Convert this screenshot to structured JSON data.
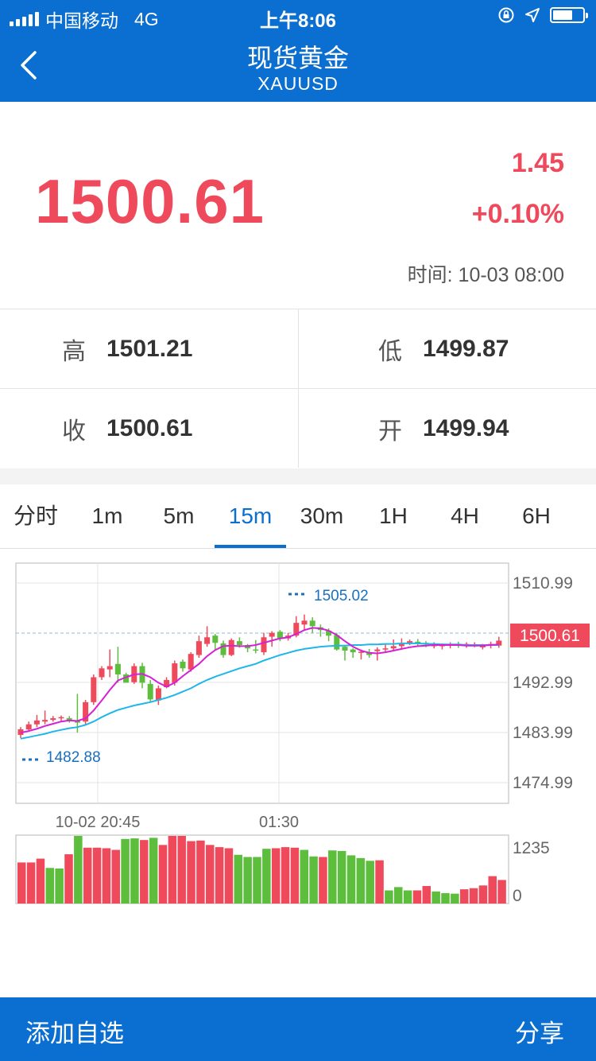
{
  "status_bar": {
    "carrier": "中国移动",
    "network": "4G",
    "time": "上午8:06"
  },
  "header": {
    "title": "现货黄金",
    "subtitle": "XAUUSD"
  },
  "quote": {
    "price": "1500.61",
    "change": "1.45",
    "change_pct": "+0.10%",
    "time_label": "时间:",
    "time_value": "10-03 08:00",
    "color_up": "#ef4a5c",
    "color_down": "#5cbe3c"
  },
  "stats": {
    "high_label": "高",
    "high": "1501.21",
    "low_label": "低",
    "low": "1499.87",
    "close_label": "收",
    "close": "1500.61",
    "open_label": "开",
    "open": "1499.94"
  },
  "tabs": [
    {
      "label": "分时",
      "active": false
    },
    {
      "label": "1m",
      "active": false
    },
    {
      "label": "5m",
      "active": false
    },
    {
      "label": "15m",
      "active": true
    },
    {
      "label": "30m",
      "active": false
    },
    {
      "label": "1H",
      "active": false
    },
    {
      "label": "4H",
      "active": false
    },
    {
      "label": "6H",
      "active": false
    }
  ],
  "chart_data": {
    "type": "candlestick",
    "y_ticks": [
      "1510.99",
      "1492.99",
      "1483.99",
      "1474.99"
    ],
    "ylim": [
      1474.99,
      1510.99
    ],
    "current_price_label": "1500.61",
    "max_label": "1505.02",
    "min_label": "1482.88",
    "x_labels": [
      "10-02 20:45",
      "01:30"
    ],
    "volume_ticks": [
      "1235",
      "0"
    ],
    "volume_max": 1235,
    "candles": [
      [
        1483.6,
        1484.6,
        1483.0,
        1485.0
      ],
      [
        1484.6,
        1485.5,
        1484.2,
        1486.0
      ],
      [
        1485.5,
        1486.2,
        1485.0,
        1487.2
      ],
      [
        1486.0,
        1486.3,
        1485.5,
        1488.0
      ],
      [
        1486.3,
        1486.6,
        1486.0,
        1487.0
      ],
      [
        1486.7,
        1486.8,
        1486.0,
        1487.1
      ],
      [
        1486.6,
        1486.2,
        1485.8,
        1487.0
      ],
      [
        1486.2,
        1485.8,
        1484.0,
        1491.0
      ],
      [
        1486.0,
        1489.5,
        1485.5,
        1489.9
      ],
      [
        1489.5,
        1494.0,
        1489.0,
        1494.5
      ],
      [
        1494.0,
        1495.6,
        1493.5,
        1496.0
      ],
      [
        1495.4,
        1496.0,
        1494.0,
        1499.0
      ],
      [
        1496.4,
        1494.5,
        1493.0,
        1499.5
      ],
      [
        1494.5,
        1493.0,
        1493.0,
        1494.8
      ],
      [
        1493.1,
        1496.0,
        1492.8,
        1496.5
      ],
      [
        1496.0,
        1493.0,
        1492.0,
        1496.6
      ],
      [
        1492.8,
        1490.0,
        1489.5,
        1493.5
      ],
      [
        1489.8,
        1492.0,
        1489.0,
        1492.5
      ],
      [
        1492.2,
        1493.5,
        1492.0,
        1494.0
      ],
      [
        1493.0,
        1496.5,
        1492.5,
        1497.0
      ],
      [
        1496.8,
        1495.6,
        1495.0,
        1497.2
      ],
      [
        1495.4,
        1498.2,
        1495.0,
        1498.5
      ],
      [
        1498.0,
        1500.5,
        1497.5,
        1501.5
      ],
      [
        1500.0,
        1501.2,
        1499.5,
        1503.2
      ],
      [
        1501.5,
        1500.2,
        1498.8,
        1501.8
      ],
      [
        1500.1,
        1498.0,
        1497.5,
        1500.6
      ],
      [
        1498.0,
        1500.7,
        1497.8,
        1501.0
      ],
      [
        1500.5,
        1499.8,
        1499.3,
        1501.2
      ],
      [
        1499.8,
        1499.2,
        1498.5,
        1500.0
      ],
      [
        1499.0,
        1498.8,
        1498.3,
        1500.7
      ],
      [
        1498.5,
        1501.2,
        1498.0,
        1502.0
      ],
      [
        1501.3,
        1502.0,
        1499.5,
        1502.3
      ],
      [
        1502.2,
        1501.0,
        1500.5,
        1502.5
      ],
      [
        1501.0,
        1501.5,
        1500.6,
        1502.0
      ],
      [
        1501.5,
        1503.8,
        1501.2,
        1505.0
      ],
      [
        1503.5,
        1504.2,
        1502.5,
        1505.3
      ],
      [
        1504.2,
        1503.2,
        1502.0,
        1504.8
      ],
      [
        1503.0,
        1502.5,
        1501.3,
        1503.5
      ],
      [
        1502.4,
        1501.5,
        1500.5,
        1502.8
      ],
      [
        1501.6,
        1499.0,
        1498.8,
        1502.0
      ],
      [
        1499.5,
        1498.8,
        1497.0,
        1499.8
      ],
      [
        1499.0,
        1498.5,
        1497.5,
        1499.2
      ],
      [
        1498.6,
        1498.6,
        1497.2,
        1499.0
      ],
      [
        1498.4,
        1498.0,
        1497.5,
        1499.1
      ],
      [
        1498.7,
        1499.0,
        1497.0,
        1499.4
      ],
      [
        1499.0,
        1499.2,
        1498.5,
        1500.0
      ],
      [
        1499.2,
        1499.6,
        1498.8,
        1500.8
      ],
      [
        1499.6,
        1500.0,
        1499.0,
        1501.0
      ],
      [
        1500.0,
        1500.5,
        1499.8,
        1500.8
      ],
      [
        1500.4,
        1500.2,
        1499.6,
        1500.9
      ],
      [
        1500.2,
        1500.1,
        1499.4,
        1500.5
      ],
      [
        1499.7,
        1499.8,
        1499.2,
        1500.3
      ],
      [
        1499.8,
        1499.8,
        1499.0,
        1500.1
      ],
      [
        1499.7,
        1499.9,
        1499.2,
        1500.3
      ],
      [
        1499.9,
        1499.7,
        1499.3,
        1500.4
      ],
      [
        1499.6,
        1500.0,
        1499.3,
        1500.3
      ],
      [
        1499.8,
        1499.9,
        1499.4,
        1500.3
      ],
      [
        1499.5,
        1499.6,
        1499.0,
        1500.0
      ],
      [
        1499.7,
        1500.0,
        1499.2,
        1500.4
      ],
      [
        1499.7,
        1500.6,
        1499.3,
        1501.3
      ]
    ],
    "ma_magenta": [
      1484.0,
      1484.3,
      1484.7,
      1485.2,
      1485.6,
      1486.0,
      1486.2,
      1486.1,
      1486.6,
      1488.0,
      1489.8,
      1491.7,
      1493.4,
      1494.0,
      1494.5,
      1494.6,
      1494.0,
      1493.0,
      1492.3,
      1493.0,
      1494.2,
      1495.3,
      1496.4,
      1497.8,
      1498.9,
      1499.6,
      1499.7,
      1499.6,
      1499.6,
      1499.8,
      1500.2,
      1500.6,
      1501.0,
      1501.2,
      1501.8,
      1502.5,
      1502.9,
      1502.8,
      1502.4,
      1501.6,
      1500.5,
      1499.5,
      1498.8,
      1498.4,
      1498.3,
      1498.5,
      1498.8,
      1499.1,
      1499.4,
      1499.6,
      1499.7,
      1499.8,
      1499.8,
      1499.8,
      1499.8,
      1499.7,
      1499.7,
      1499.7,
      1499.8,
      1499.9
    ],
    "ma_cyan": [
      1482.9,
      1483.2,
      1483.5,
      1483.8,
      1484.2,
      1484.5,
      1484.8,
      1485.0,
      1485.4,
      1486.0,
      1486.8,
      1487.5,
      1488.1,
      1488.5,
      1488.9,
      1489.2,
      1489.5,
      1489.9,
      1490.3,
      1490.8,
      1491.4,
      1492.0,
      1492.8,
      1493.5,
      1494.1,
      1494.6,
      1495.1,
      1495.6,
      1496.0,
      1496.4,
      1497.0,
      1497.5,
      1498.0,
      1498.4,
      1498.8,
      1499.1,
      1499.3,
      1499.5,
      1499.6,
      1499.7,
      1499.7,
      1499.8,
      1499.8,
      1499.9,
      1499.9,
      1500.0,
      1500.0,
      1500.1,
      1500.1,
      1500.1,
      1500.0,
      1500.0,
      1499.9,
      1499.9,
      1499.9,
      1499.8,
      1499.8,
      1499.8,
      1499.8,
      1499.8
    ],
    "volume": [
      {
        "v": 750,
        "up": true
      },
      {
        "v": 750,
        "up": true
      },
      {
        "v": 820,
        "up": true
      },
      {
        "v": 650,
        "up": false
      },
      {
        "v": 640,
        "up": false
      },
      {
        "v": 900,
        "up": true
      },
      {
        "v": 1235,
        "up": false
      },
      {
        "v": 1020,
        "up": true
      },
      {
        "v": 1020,
        "up": true
      },
      {
        "v": 1010,
        "up": true
      },
      {
        "v": 980,
        "up": true
      },
      {
        "v": 1180,
        "up": false
      },
      {
        "v": 1190,
        "up": false
      },
      {
        "v": 1160,
        "up": true
      },
      {
        "v": 1200,
        "up": false
      },
      {
        "v": 1070,
        "up": true
      },
      {
        "v": 1235,
        "up": true
      },
      {
        "v": 1235,
        "up": true
      },
      {
        "v": 1140,
        "up": true
      },
      {
        "v": 1150,
        "up": true
      },
      {
        "v": 1070,
        "up": true
      },
      {
        "v": 1030,
        "up": true
      },
      {
        "v": 1010,
        "up": true
      },
      {
        "v": 890,
        "up": false
      },
      {
        "v": 850,
        "up": false
      },
      {
        "v": 850,
        "up": false
      },
      {
        "v": 1000,
        "up": false
      },
      {
        "v": 1010,
        "up": true
      },
      {
        "v": 1030,
        "up": true
      },
      {
        "v": 1020,
        "up": true
      },
      {
        "v": 980,
        "up": false
      },
      {
        "v": 860,
        "up": false
      },
      {
        "v": 850,
        "up": true
      },
      {
        "v": 970,
        "up": false
      },
      {
        "v": 960,
        "up": false
      },
      {
        "v": 880,
        "up": false
      },
      {
        "v": 830,
        "up": false
      },
      {
        "v": 780,
        "up": false
      },
      {
        "v": 790,
        "up": true
      },
      {
        "v": 240,
        "up": false
      },
      {
        "v": 300,
        "up": false
      },
      {
        "v": 240,
        "up": false
      },
      {
        "v": 240,
        "up": true
      },
      {
        "v": 320,
        "up": true
      },
      {
        "v": 220,
        "up": false
      },
      {
        "v": 190,
        "up": false
      },
      {
        "v": 180,
        "up": false
      },
      {
        "v": 260,
        "up": true
      },
      {
        "v": 280,
        "up": true
      },
      {
        "v": 330,
        "up": true
      },
      {
        "v": 500,
        "up": true
      },
      {
        "v": 430,
        "up": true
      }
    ]
  },
  "bottom_bar": {
    "add_label": "添加自选",
    "share_label": "分享"
  }
}
